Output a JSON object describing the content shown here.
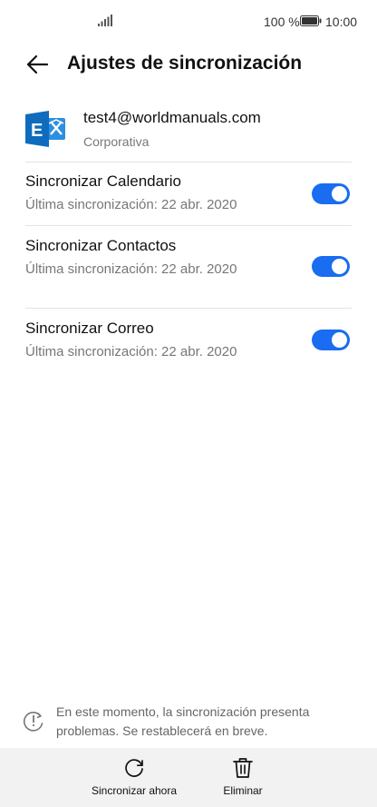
{
  "status_bar": {
    "battery": "100 %",
    "time": "10:00"
  },
  "header": {
    "title": "Ajustes de sincronización"
  },
  "account": {
    "email": "test4@worldmanuals.com",
    "type": "Corporativa",
    "logo_icon": "exchange-logo"
  },
  "sync_items": [
    {
      "label": "Sincronizar Calendario",
      "last_sync": "Última sincronización: 22 abr. 2020",
      "enabled": true
    },
    {
      "label": "Sincronizar Contactos",
      "last_sync": "Última sincronización: 22 abr. 2020",
      "enabled": true
    },
    {
      "label": "Sincronizar Correo",
      "last_sync": "Última sincronización: 22 abr. 2020",
      "enabled": true
    }
  ],
  "notice": {
    "text": "En este momento, la sincronización presenta problemas. Se restablecerá en breve."
  },
  "actions": {
    "sync_now": "Sincronizar ahora",
    "delete": "Eliminar"
  },
  "colors": {
    "accent": "#1a6cf0",
    "exchange_blue": "#0f6cbd"
  }
}
